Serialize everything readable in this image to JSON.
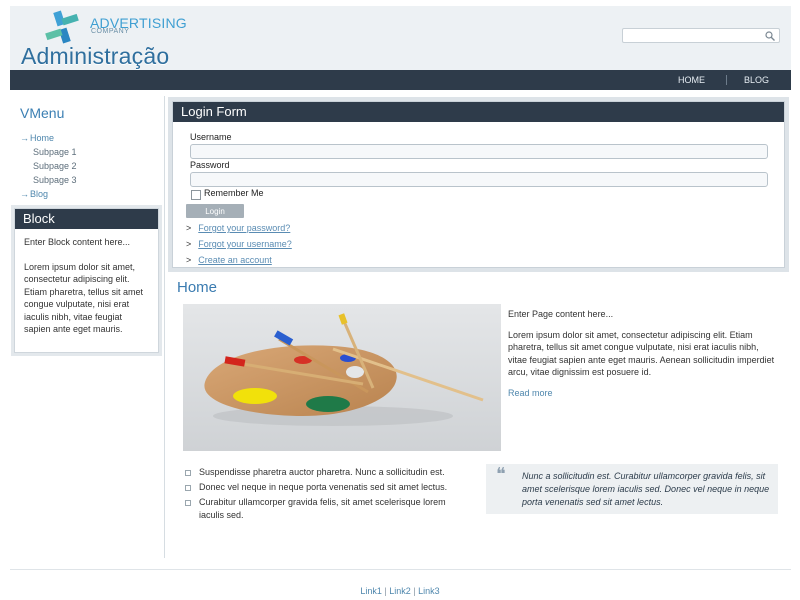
{
  "header": {
    "logo_line1": "ADVERTISING",
    "logo_line2": "COMPANY",
    "site_title": "Administração",
    "search_placeholder": ""
  },
  "topnav": {
    "items": [
      {
        "label": "HOME"
      },
      {
        "label": "BLOG"
      }
    ]
  },
  "vmenu": {
    "title": "VMenu",
    "items": [
      {
        "label": "Home",
        "level": 1
      },
      {
        "label": "Subpage 1",
        "level": 2
      },
      {
        "label": "Subpage 2",
        "level": 2
      },
      {
        "label": "Subpage 3",
        "level": 2
      },
      {
        "label": "Blog",
        "level": 1
      }
    ],
    "arrow": "→"
  },
  "block": {
    "title": "Block",
    "intro": "Enter Block content here...",
    "body": "Lorem ipsum dolor sit amet, consectetur adipiscing elit. Etiam pharetra, tellus sit amet congue vulputate, nisi erat iaculis nibh, vitae feugiat sapien ante eget mauris."
  },
  "login": {
    "title": "Login Form",
    "username_label": "Username",
    "password_label": "Password",
    "remember_label": "Remember Me",
    "button_label": "Login",
    "links": [
      {
        "label": "Forgot your password?"
      },
      {
        "label": "Forgot your username?"
      },
      {
        "label": "Create an account"
      }
    ],
    "chevron": ">"
  },
  "main": {
    "title": "Home",
    "intro": "Enter Page content here...",
    "paragraph": "Lorem ipsum dolor sit amet, consectetur adipiscing elit. Etiam pharetra, tellus sit amet congue vulputate, nisi erat iaculis nibh, vitae feugiat sapien ante eget mauris. Aenean sollicitudin imperdiet arcu, vitae dignissim est posuere id.",
    "read_more": "Read more",
    "bullets": [
      "Suspendisse pharetra auctor pharetra. Nunc a sollicitudin est.",
      "Donec vel neque in neque porta venenatis sed sit amet lectus.",
      "Curabitur ullamcorper gravida felis, sit amet scelerisque lorem iaculis sed."
    ],
    "quote": "Nunc a sollicitudin est. Curabitur ullamcorper gravida felis, sit amet scelerisque lorem iaculis sed. Donec vel neque in neque porta venenatis sed sit amet lectus.",
    "quote_mark": "❝"
  },
  "footer": {
    "links": [
      "Link1",
      "Link2",
      "Link3"
    ],
    "separator": "|"
  },
  "colors": {
    "nav_bg": "#2e3b4a",
    "accent": "#3b7fb3",
    "link": "#4f87ad",
    "header_bg": "#edf1f4"
  },
  "icons": {
    "search": "search-icon",
    "logo": "logo-pinwheel-icon",
    "quote": "quote-icon",
    "palette": "paint-palette-image"
  }
}
